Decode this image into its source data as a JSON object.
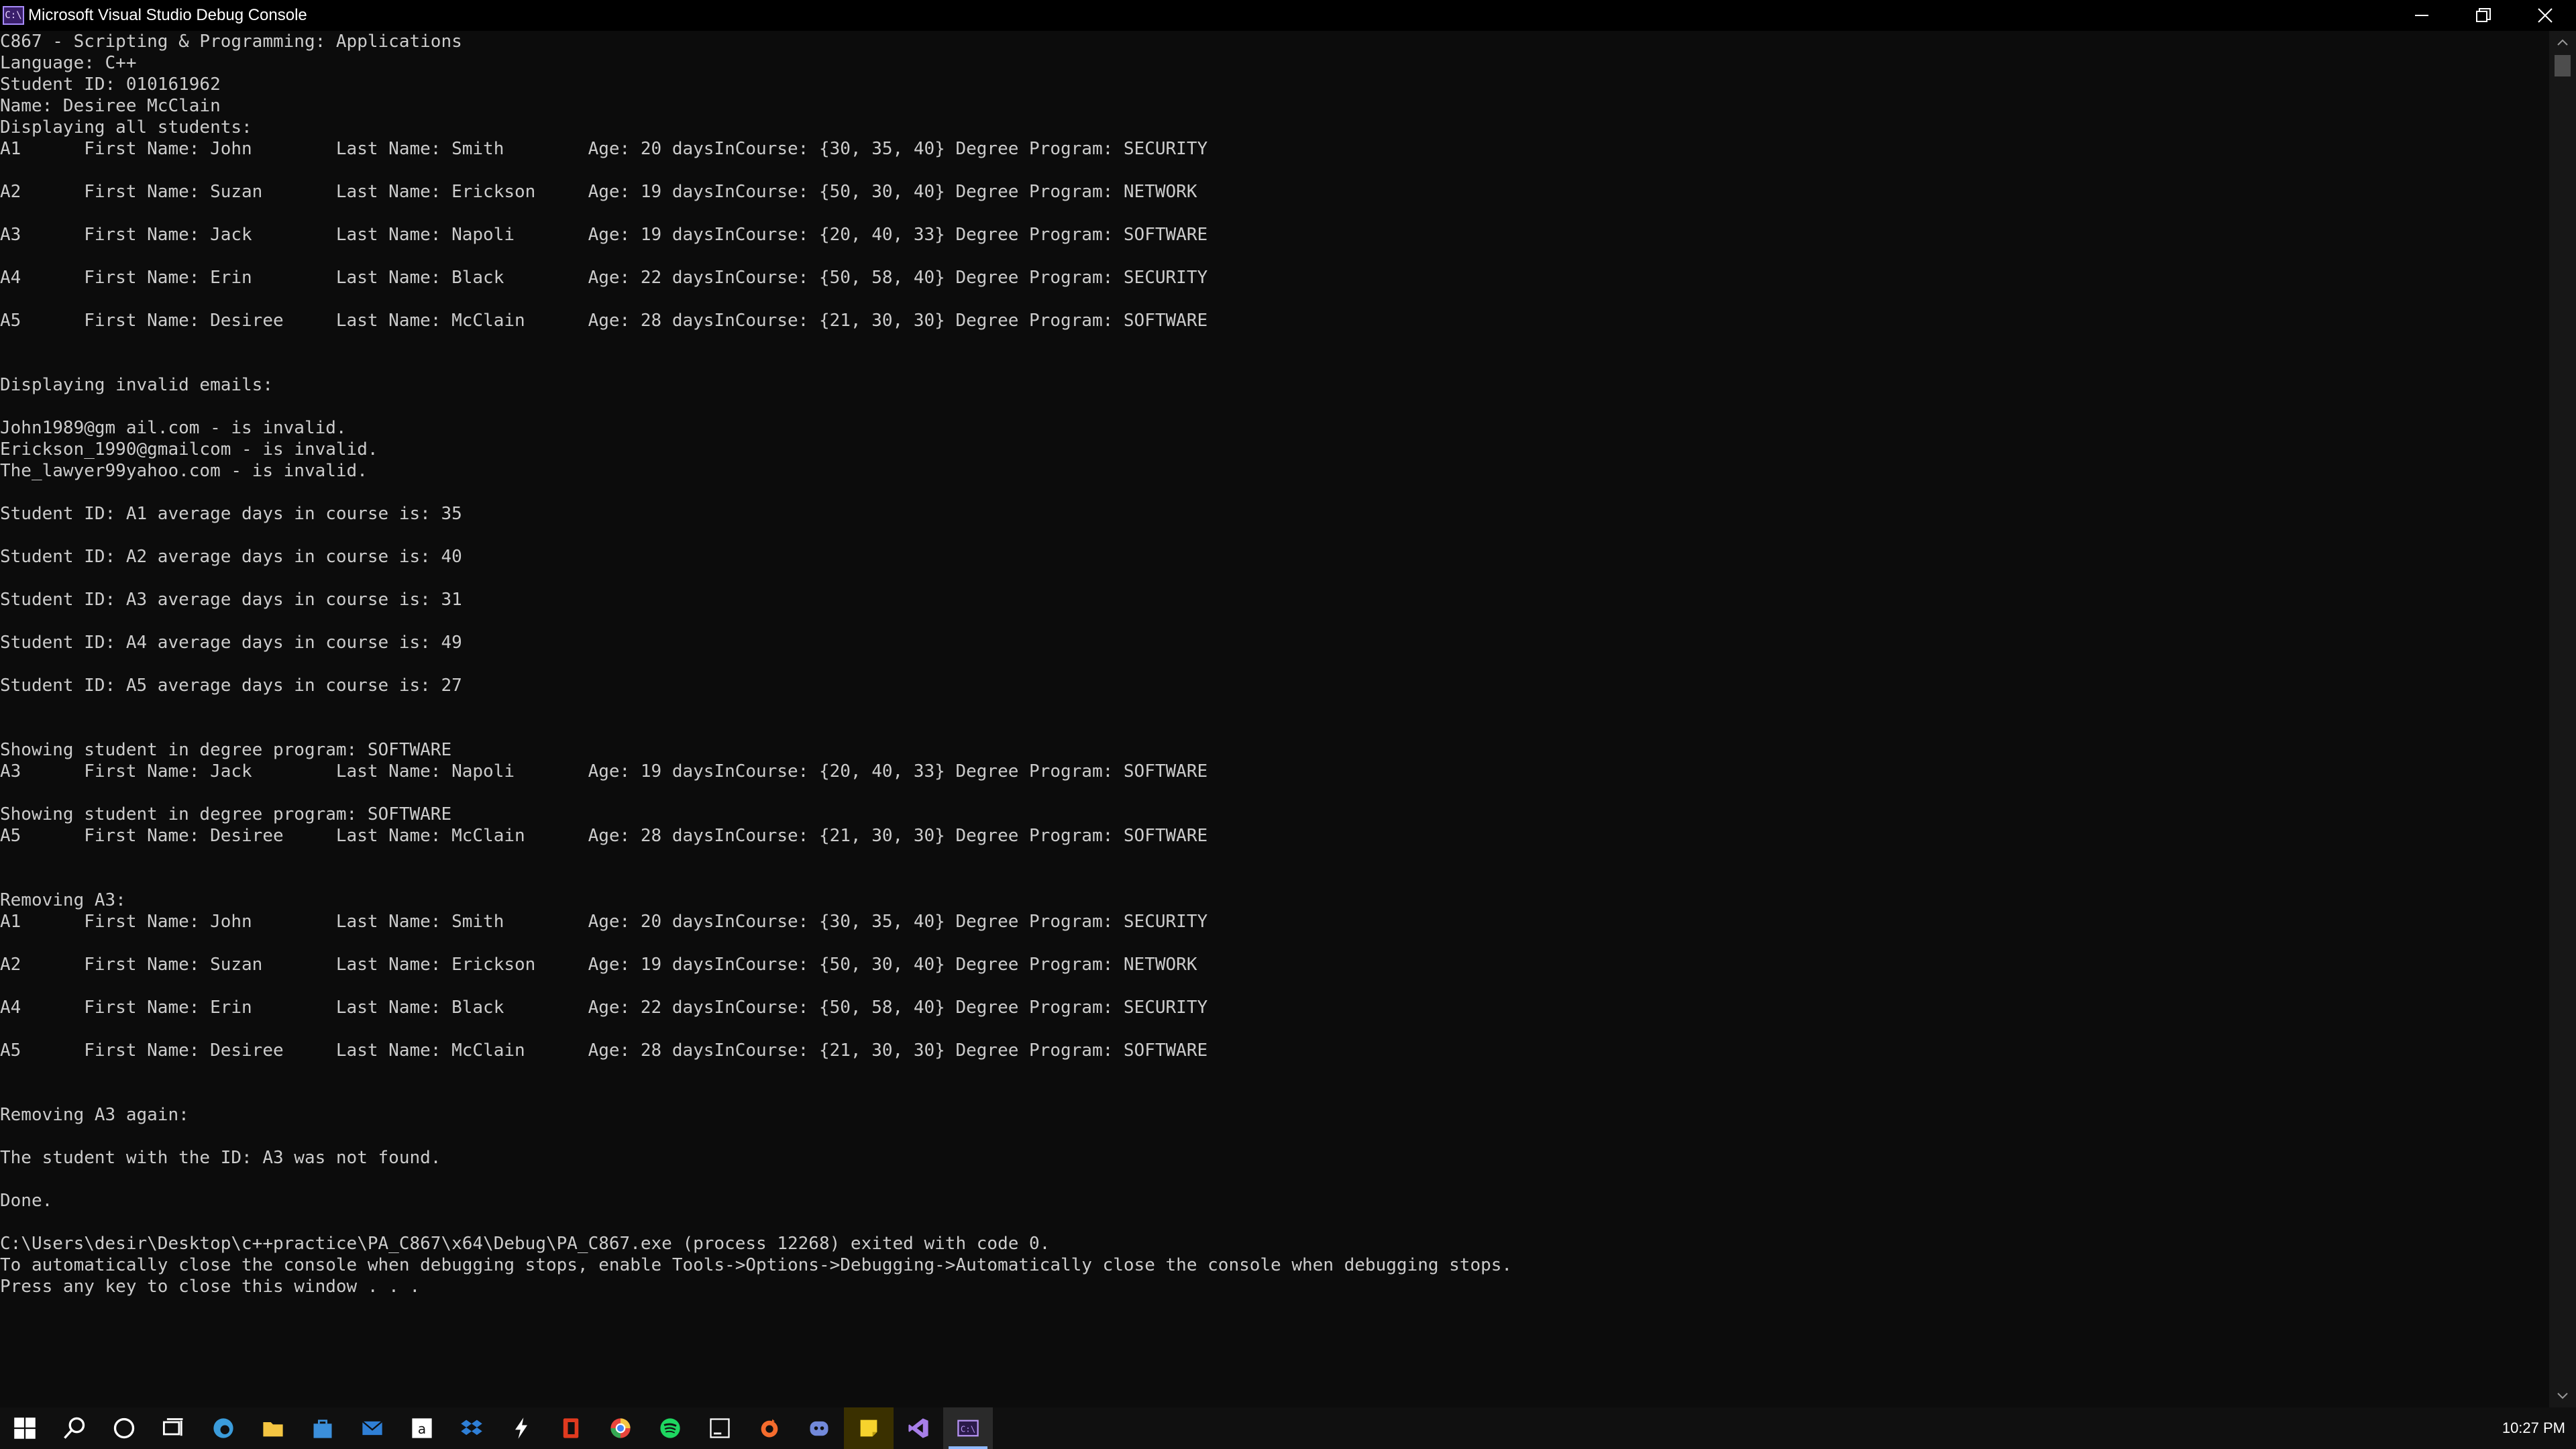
{
  "window": {
    "title": "Microsoft Visual Studio Debug Console",
    "app_icon_text": "C:\\"
  },
  "console_lines": [
    "C867 - Scripting & Programming: Applications",
    "Language: C++",
    "Student ID: 010161962",
    "Name: Desiree McClain",
    "Displaying all students:",
    "A1      First Name: John        Last Name: Smith        Age: 20 daysInCourse: {30, 35, 40} Degree Program: SECURITY",
    "",
    "A2      First Name: Suzan       Last Name: Erickson     Age: 19 daysInCourse: {50, 30, 40} Degree Program: NETWORK",
    "",
    "A3      First Name: Jack        Last Name: Napoli       Age: 19 daysInCourse: {20, 40, 33} Degree Program: SOFTWARE",
    "",
    "A4      First Name: Erin        Last Name: Black        Age: 22 daysInCourse: {50, 58, 40} Degree Program: SECURITY",
    "",
    "A5      First Name: Desiree     Last Name: McClain      Age: 28 daysInCourse: {21, 30, 30} Degree Program: SOFTWARE",
    "",
    "",
    "Displaying invalid emails:",
    "",
    "John1989@gm ail.com - is invalid.",
    "Erickson_1990@gmailcom - is invalid.",
    "The_lawyer99yahoo.com - is invalid.",
    "",
    "Student ID: A1 average days in course is: 35",
    "",
    "Student ID: A2 average days in course is: 40",
    "",
    "Student ID: A3 average days in course is: 31",
    "",
    "Student ID: A4 average days in course is: 49",
    "",
    "Student ID: A5 average days in course is: 27",
    "",
    "",
    "Showing student in degree program: SOFTWARE",
    "A3      First Name: Jack        Last Name: Napoli       Age: 19 daysInCourse: {20, 40, 33} Degree Program: SOFTWARE",
    "",
    "Showing student in degree program: SOFTWARE",
    "A5      First Name: Desiree     Last Name: McClain      Age: 28 daysInCourse: {21, 30, 30} Degree Program: SOFTWARE",
    "",
    "",
    "Removing A3:",
    "A1      First Name: John        Last Name: Smith        Age: 20 daysInCourse: {30, 35, 40} Degree Program: SECURITY",
    "",
    "A2      First Name: Suzan       Last Name: Erickson     Age: 19 daysInCourse: {50, 30, 40} Degree Program: NETWORK",
    "",
    "A4      First Name: Erin        Last Name: Black        Age: 22 daysInCourse: {50, 58, 40} Degree Program: SECURITY",
    "",
    "A5      First Name: Desiree     Last Name: McClain      Age: 28 daysInCourse: {21, 30, 30} Degree Program: SOFTWARE",
    "",
    "",
    "Removing A3 again:",
    "",
    "The student with the ID: A3 was not found.",
    "",
    "Done.",
    "",
    "C:\\Users\\desir\\Desktop\\c++practice\\PA_C867\\x64\\Debug\\PA_C867.exe (process 12268) exited with code 0.",
    "To automatically close the console when debugging stops, enable Tools->Options->Debugging->Automatically close the console when debugging stops.",
    "Press any key to close this window . . ."
  ],
  "taskbar": {
    "items": [
      {
        "icon": "windows-start-icon",
        "color": "#ffffff"
      },
      {
        "icon": "search-icon",
        "color": "#ffffff"
      },
      {
        "icon": "cortana-icon",
        "color": "#ffffff"
      },
      {
        "icon": "task-view-icon",
        "color": "#ffffff"
      },
      {
        "icon": "edge-icon",
        "color": "#3b9cdb"
      },
      {
        "icon": "file-explorer-icon",
        "color": "#f4c542"
      },
      {
        "icon": "store-icon",
        "color": "#3b8fdb"
      },
      {
        "icon": "mail-icon",
        "color": "#2f7fd6"
      },
      {
        "icon": "amazon-icon",
        "color": "#ffffff"
      },
      {
        "icon": "dropbox-icon",
        "color": "#2f7fd6"
      },
      {
        "icon": "lightning-app-icon",
        "color": "#ffffff"
      },
      {
        "icon": "office-icon",
        "color": "#e03a1f"
      },
      {
        "icon": "chrome-icon",
        "color": "#e8453c"
      },
      {
        "icon": "spotify-icon",
        "color": "#1ed760"
      },
      {
        "icon": "jetbrains-icon",
        "color": "#ffffff"
      },
      {
        "icon": "origin-icon",
        "color": "#f56c2d"
      },
      {
        "icon": "discord-icon",
        "color": "#7289da"
      },
      {
        "icon": "sticky-notes-icon",
        "color": "#f6d32d"
      },
      {
        "icon": "visual-studio-icon",
        "color": "#a77ee8"
      },
      {
        "icon": "debug-console-icon",
        "color": "#b794f4"
      }
    ],
    "clock": "10:27 PM"
  }
}
